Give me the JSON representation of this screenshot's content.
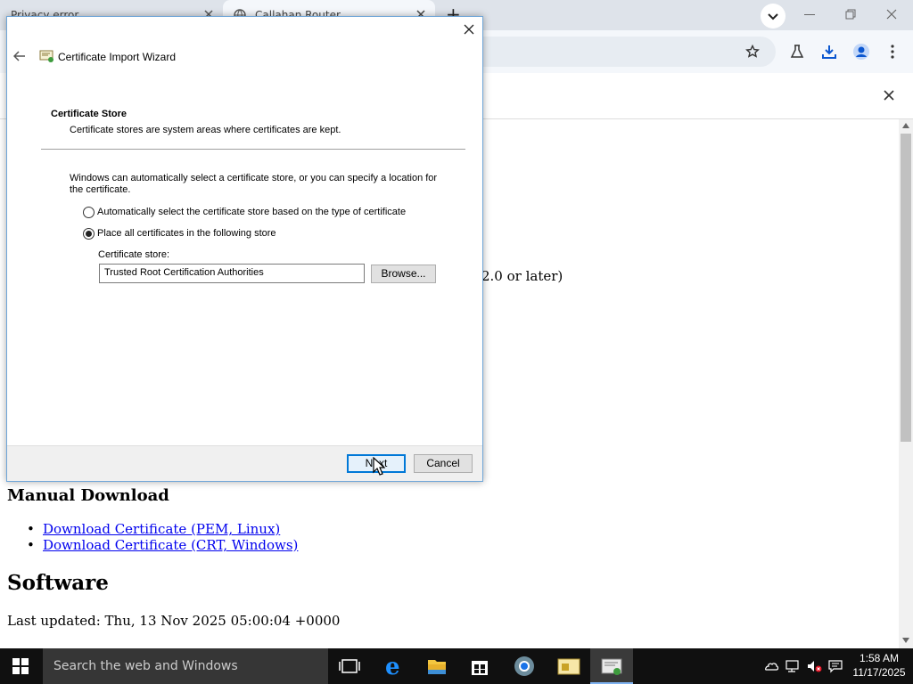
{
  "browser": {
    "tabs": [
      {
        "title": "Privacy error",
        "active": false
      },
      {
        "title": "Callahan Router",
        "active": true
      }
    ],
    "new_tab_label": "+"
  },
  "page": {
    "partial_text": "2.0 or later)",
    "manual_download_heading": "Manual Download",
    "links": [
      "Download Certificate (PEM, Linux)",
      "Download Certificate (CRT, Windows)"
    ],
    "software_heading": "Software",
    "last_updated": "Last updated: Thu, 13 Nov 2025 05:00:04 +0000"
  },
  "dialog": {
    "title": "Certificate Import Wizard",
    "section_title": "Certificate Store",
    "section_subtitle": "Certificate stores are system areas where certificates are kept.",
    "description_line1": "Windows can automatically select a certificate store, or you can specify a location for",
    "description_line2": "the certificate.",
    "option_auto": "Automatically select the certificate store based on the type of certificate",
    "option_manual": "Place all certificates in the following store",
    "selected_option": "manual",
    "store_label": "Certificate store:",
    "store_value": "Trusted Root Certification Authorities",
    "browse_label": "Browse...",
    "next_label": "Next",
    "cancel_label": "Cancel"
  },
  "taskbar": {
    "search_placeholder": "Search the web and Windows",
    "time": "1:58 AM",
    "date": "11/17/2025"
  },
  "colors": {
    "accent": "#0078d7",
    "link": "#0000ee",
    "taskbar": "#101010"
  }
}
